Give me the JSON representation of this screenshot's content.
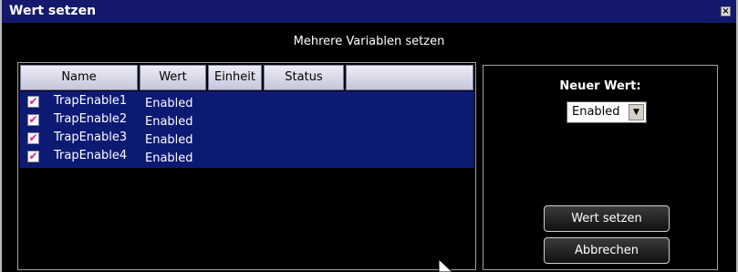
{
  "window": {
    "title": "Wert setzen",
    "close_glyph": "×"
  },
  "dialog": {
    "subtitle": "Mehrere Variablen setzen"
  },
  "table": {
    "columns": [
      "Name",
      "Wert",
      "Einheit",
      "Status",
      ""
    ],
    "rows": [
      {
        "checked": true,
        "name": "TrapEnable1",
        "value": "Enabled"
      },
      {
        "checked": true,
        "name": "TrapEnable2",
        "value": "Enabled"
      },
      {
        "checked": true,
        "name": "TrapEnable3",
        "value": "Enabled"
      },
      {
        "checked": true,
        "name": "TrapEnable4",
        "value": "Enabled"
      }
    ]
  },
  "right_panel": {
    "new_value_label": "Neuer Wert:",
    "select_value": "Enabled",
    "set_button": "Wert setzen",
    "cancel_button": "Abbrechen"
  },
  "icons": {
    "checkbox_check": "✔",
    "dropdown_arrow": "▼"
  },
  "colors": {
    "titlebar": "#14196e",
    "selection": "#0c1a74",
    "checkmark": "#e0208c",
    "background": "#000000"
  }
}
